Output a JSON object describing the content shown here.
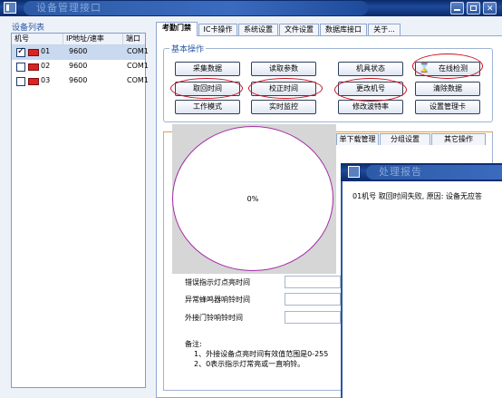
{
  "window": {
    "title": "设备管理接口"
  },
  "device_list": {
    "group_title": "设备列表",
    "columns": [
      "机号",
      "IP地址/速率",
      "端口"
    ],
    "rows": [
      {
        "no": "01",
        "addr": "9600",
        "port": "COM1",
        "checked": true
      },
      {
        "no": "02",
        "addr": "9600",
        "port": "COM1",
        "checked": false
      },
      {
        "no": "03",
        "addr": "9600",
        "port": "COM1",
        "checked": false
      }
    ]
  },
  "tabs": [
    "考勤门禁",
    "IC卡操作",
    "系统设置",
    "文件设置",
    "数据库接口",
    "关于..."
  ],
  "basic": {
    "title": "基本操作",
    "buttons": [
      "采集数据",
      "读取参数",
      "机具状态",
      "在线检测",
      "取回时间",
      "校正时间",
      "更改机号",
      "清除数据",
      "工作模式",
      "实时监控",
      "修改波特率",
      "设置管理卡"
    ]
  },
  "sub_tabs": [
    "单下载管理",
    "分组设置",
    "其它操作"
  ],
  "progress": {
    "percent_label": "0%",
    "value": 0
  },
  "fields": [
    "错误指示灯点亮时间",
    "异常蜂鸣器响铃时间",
    "外接门铃响铃时间"
  ],
  "notes": {
    "title": "备注:",
    "line1": "1、外接设备点亮时间有效值范围是0-255",
    "line2": "2、0表示指示灯常亮或一直响铃。"
  },
  "dialog": {
    "title": "处理报告",
    "message": "01机号 取回时间失败, 原因: 设备无应答"
  },
  "colors": {
    "title_bar": "#1e4a9a",
    "highlight_ring": "#cc1020",
    "progress_ring": "#a42ea8",
    "group_title": "#2c5aa6"
  }
}
